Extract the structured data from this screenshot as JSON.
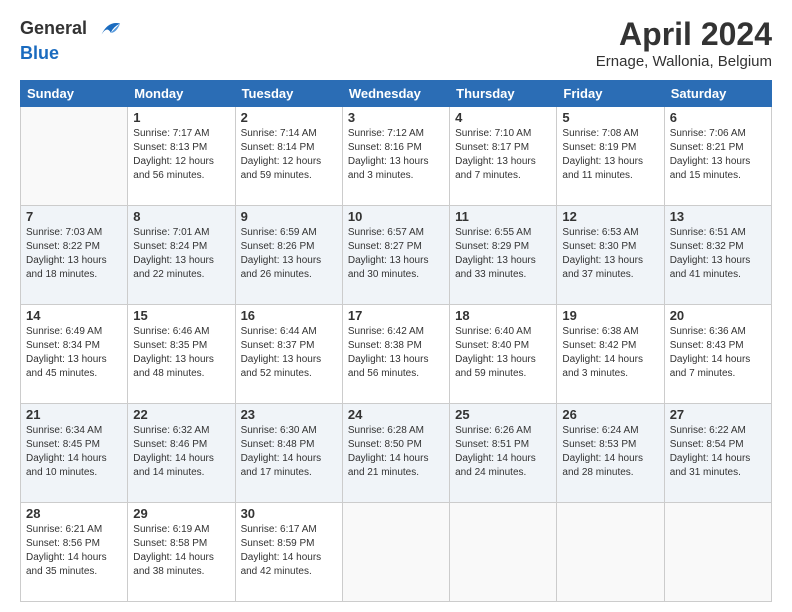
{
  "logo": {
    "general": "General",
    "blue": "Blue"
  },
  "header": {
    "title": "April 2024",
    "location": "Ernage, Wallonia, Belgium"
  },
  "calendar": {
    "days_of_week": [
      "Sunday",
      "Monday",
      "Tuesday",
      "Wednesday",
      "Thursday",
      "Friday",
      "Saturday"
    ],
    "weeks": [
      [
        {
          "day": "",
          "info": ""
        },
        {
          "day": "1",
          "info": "Sunrise: 7:17 AM\nSunset: 8:13 PM\nDaylight: 12 hours\nand 56 minutes."
        },
        {
          "day": "2",
          "info": "Sunrise: 7:14 AM\nSunset: 8:14 PM\nDaylight: 12 hours\nand 59 minutes."
        },
        {
          "day": "3",
          "info": "Sunrise: 7:12 AM\nSunset: 8:16 PM\nDaylight: 13 hours\nand 3 minutes."
        },
        {
          "day": "4",
          "info": "Sunrise: 7:10 AM\nSunset: 8:17 PM\nDaylight: 13 hours\nand 7 minutes."
        },
        {
          "day": "5",
          "info": "Sunrise: 7:08 AM\nSunset: 8:19 PM\nDaylight: 13 hours\nand 11 minutes."
        },
        {
          "day": "6",
          "info": "Sunrise: 7:06 AM\nSunset: 8:21 PM\nDaylight: 13 hours\nand 15 minutes."
        }
      ],
      [
        {
          "day": "7",
          "info": "Sunrise: 7:03 AM\nSunset: 8:22 PM\nDaylight: 13 hours\nand 18 minutes."
        },
        {
          "day": "8",
          "info": "Sunrise: 7:01 AM\nSunset: 8:24 PM\nDaylight: 13 hours\nand 22 minutes."
        },
        {
          "day": "9",
          "info": "Sunrise: 6:59 AM\nSunset: 8:26 PM\nDaylight: 13 hours\nand 26 minutes."
        },
        {
          "day": "10",
          "info": "Sunrise: 6:57 AM\nSunset: 8:27 PM\nDaylight: 13 hours\nand 30 minutes."
        },
        {
          "day": "11",
          "info": "Sunrise: 6:55 AM\nSunset: 8:29 PM\nDaylight: 13 hours\nand 33 minutes."
        },
        {
          "day": "12",
          "info": "Sunrise: 6:53 AM\nSunset: 8:30 PM\nDaylight: 13 hours\nand 37 minutes."
        },
        {
          "day": "13",
          "info": "Sunrise: 6:51 AM\nSunset: 8:32 PM\nDaylight: 13 hours\nand 41 minutes."
        }
      ],
      [
        {
          "day": "14",
          "info": "Sunrise: 6:49 AM\nSunset: 8:34 PM\nDaylight: 13 hours\nand 45 minutes."
        },
        {
          "day": "15",
          "info": "Sunrise: 6:46 AM\nSunset: 8:35 PM\nDaylight: 13 hours\nand 48 minutes."
        },
        {
          "day": "16",
          "info": "Sunrise: 6:44 AM\nSunset: 8:37 PM\nDaylight: 13 hours\nand 52 minutes."
        },
        {
          "day": "17",
          "info": "Sunrise: 6:42 AM\nSunset: 8:38 PM\nDaylight: 13 hours\nand 56 minutes."
        },
        {
          "day": "18",
          "info": "Sunrise: 6:40 AM\nSunset: 8:40 PM\nDaylight: 13 hours\nand 59 minutes."
        },
        {
          "day": "19",
          "info": "Sunrise: 6:38 AM\nSunset: 8:42 PM\nDaylight: 14 hours\nand 3 minutes."
        },
        {
          "day": "20",
          "info": "Sunrise: 6:36 AM\nSunset: 8:43 PM\nDaylight: 14 hours\nand 7 minutes."
        }
      ],
      [
        {
          "day": "21",
          "info": "Sunrise: 6:34 AM\nSunset: 8:45 PM\nDaylight: 14 hours\nand 10 minutes."
        },
        {
          "day": "22",
          "info": "Sunrise: 6:32 AM\nSunset: 8:46 PM\nDaylight: 14 hours\nand 14 minutes."
        },
        {
          "day": "23",
          "info": "Sunrise: 6:30 AM\nSunset: 8:48 PM\nDaylight: 14 hours\nand 17 minutes."
        },
        {
          "day": "24",
          "info": "Sunrise: 6:28 AM\nSunset: 8:50 PM\nDaylight: 14 hours\nand 21 minutes."
        },
        {
          "day": "25",
          "info": "Sunrise: 6:26 AM\nSunset: 8:51 PM\nDaylight: 14 hours\nand 24 minutes."
        },
        {
          "day": "26",
          "info": "Sunrise: 6:24 AM\nSunset: 8:53 PM\nDaylight: 14 hours\nand 28 minutes."
        },
        {
          "day": "27",
          "info": "Sunrise: 6:22 AM\nSunset: 8:54 PM\nDaylight: 14 hours\nand 31 minutes."
        }
      ],
      [
        {
          "day": "28",
          "info": "Sunrise: 6:21 AM\nSunset: 8:56 PM\nDaylight: 14 hours\nand 35 minutes."
        },
        {
          "day": "29",
          "info": "Sunrise: 6:19 AM\nSunset: 8:58 PM\nDaylight: 14 hours\nand 38 minutes."
        },
        {
          "day": "30",
          "info": "Sunrise: 6:17 AM\nSunset: 8:59 PM\nDaylight: 14 hours\nand 42 minutes."
        },
        {
          "day": "",
          "info": ""
        },
        {
          "day": "",
          "info": ""
        },
        {
          "day": "",
          "info": ""
        },
        {
          "day": "",
          "info": ""
        }
      ]
    ]
  }
}
